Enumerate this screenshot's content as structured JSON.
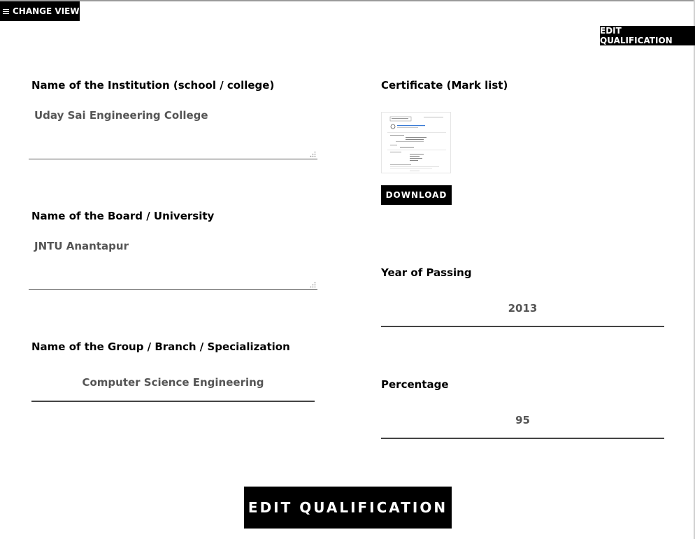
{
  "toolbar": {
    "change_view_label": "CHANGE VIEW",
    "menu_icon": "hamburger-menu-icon",
    "edit_qualification_label": "EDIT QUALIFICATION"
  },
  "form": {
    "institution": {
      "label": "Name of the Institution (school / college)",
      "value": "Uday Sai Engineering College"
    },
    "board": {
      "label": "Name of the Board / University",
      "value": "JNTU Anantapur"
    },
    "group": {
      "label": "Name of the Group / Branch / Specialization",
      "value": "Computer Science Engineering"
    },
    "certificate": {
      "label": "Certificate (Mark list)",
      "download_label": "DOWNLOAD"
    },
    "year": {
      "label": "Year of Passing",
      "value": "2013"
    },
    "percentage": {
      "label": "Percentage",
      "value": "95"
    }
  },
  "footer": {
    "edit_qualification_label": "EDIT QUALIFICATION"
  },
  "colors": {
    "button_bg": "#000000",
    "button_text": "#ffffff",
    "value_text": "#555555"
  }
}
